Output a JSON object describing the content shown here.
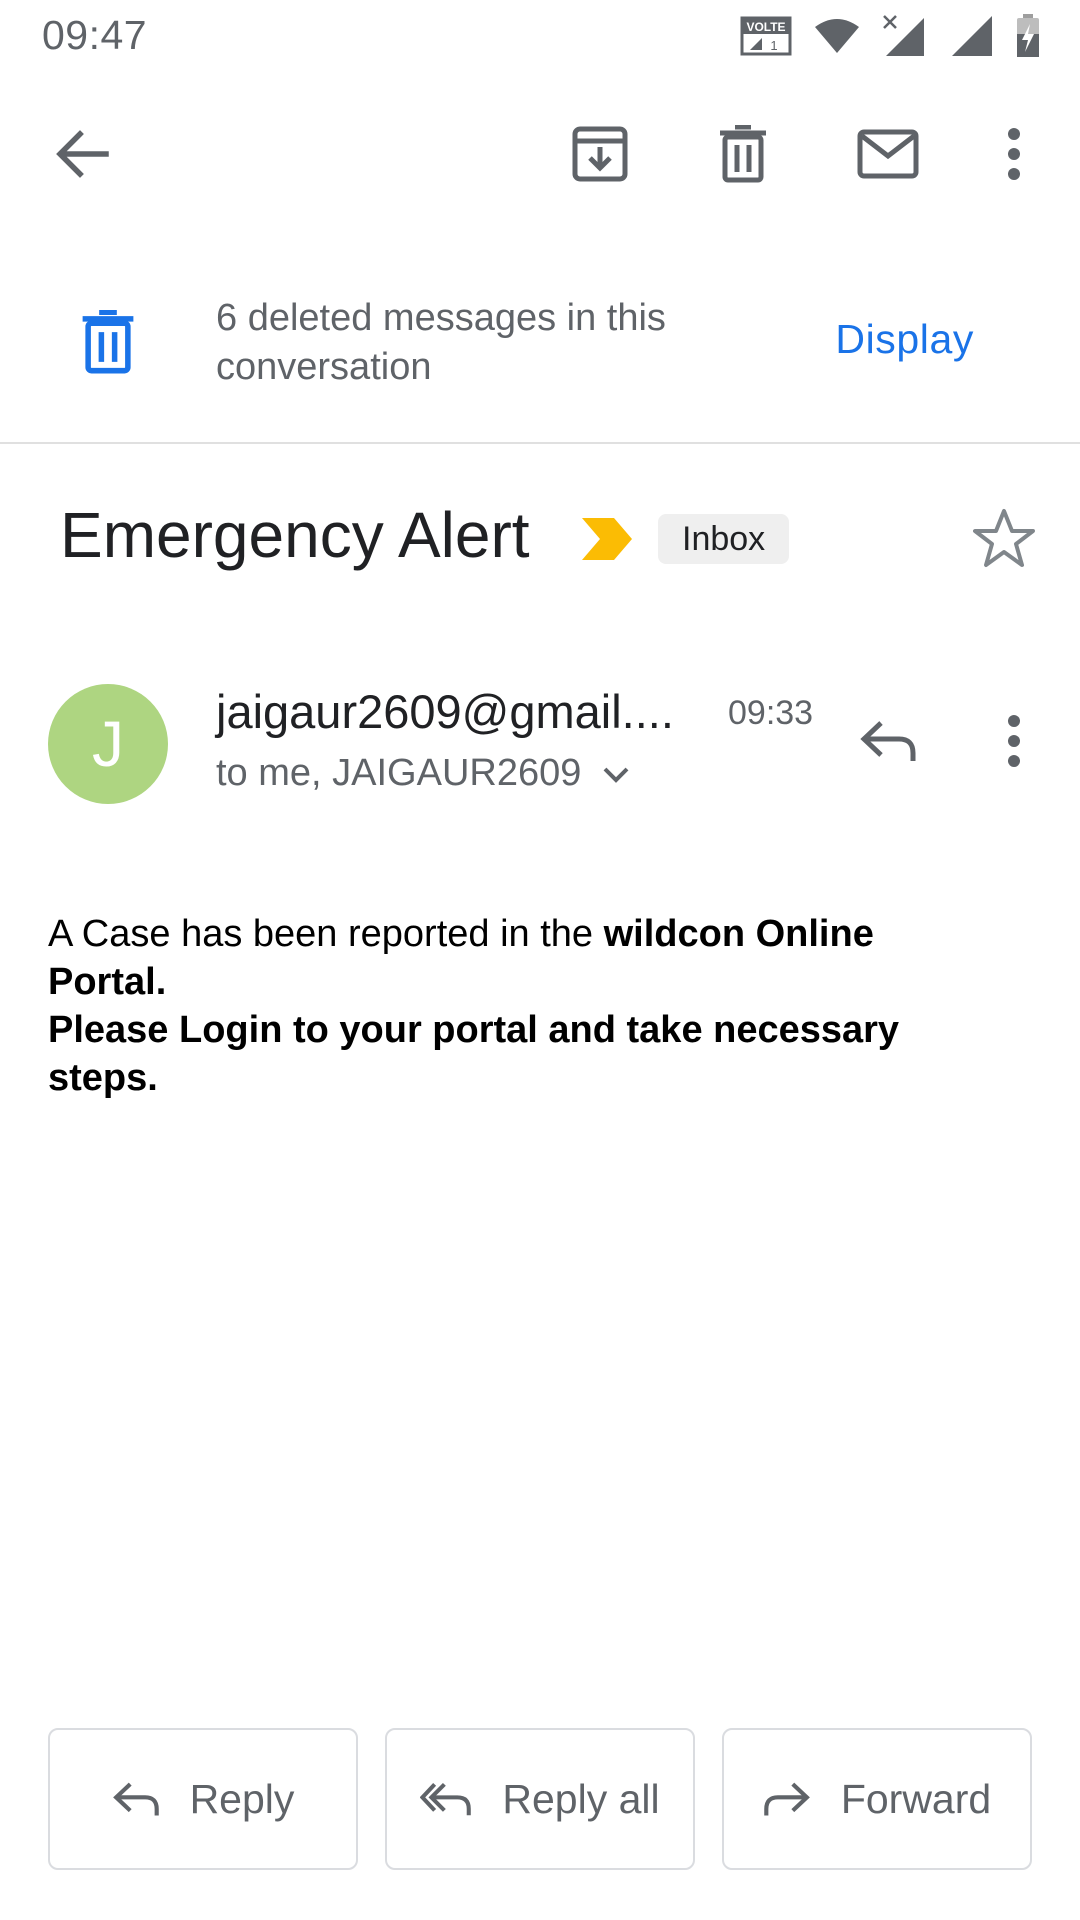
{
  "status_bar": {
    "time": "09:47",
    "icons": [
      "volte-icon",
      "wifi-icon",
      "signal-no-service-icon",
      "signal-icon",
      "battery-charging-icon"
    ]
  },
  "toolbar": {
    "icons": [
      "back-arrow-icon",
      "archive-icon",
      "trash-icon",
      "mail-icon",
      "more-vert-icon"
    ]
  },
  "deleted_banner": {
    "text": "6 deleted messages in this conversation",
    "action": "Display",
    "accent_color": "#1a73e8"
  },
  "email": {
    "subject": "Emergency Alert",
    "label": "Inbox",
    "importance_color": "#fbbc04",
    "sender": {
      "initial": "J",
      "address": "jaigaur2609@gmail....",
      "time": "09:33",
      "recipients": "to me, JAIGAUR2609",
      "avatar_color": "#aed581"
    },
    "body": {
      "line1_normal": "A Case has been reported in the ",
      "line1_bold": "wildcon Online Portal.",
      "line2_bold": "Please Login to your portal and take necessary steps."
    }
  },
  "actions": {
    "reply": "Reply",
    "reply_all": "Reply all",
    "forward": "Forward"
  }
}
